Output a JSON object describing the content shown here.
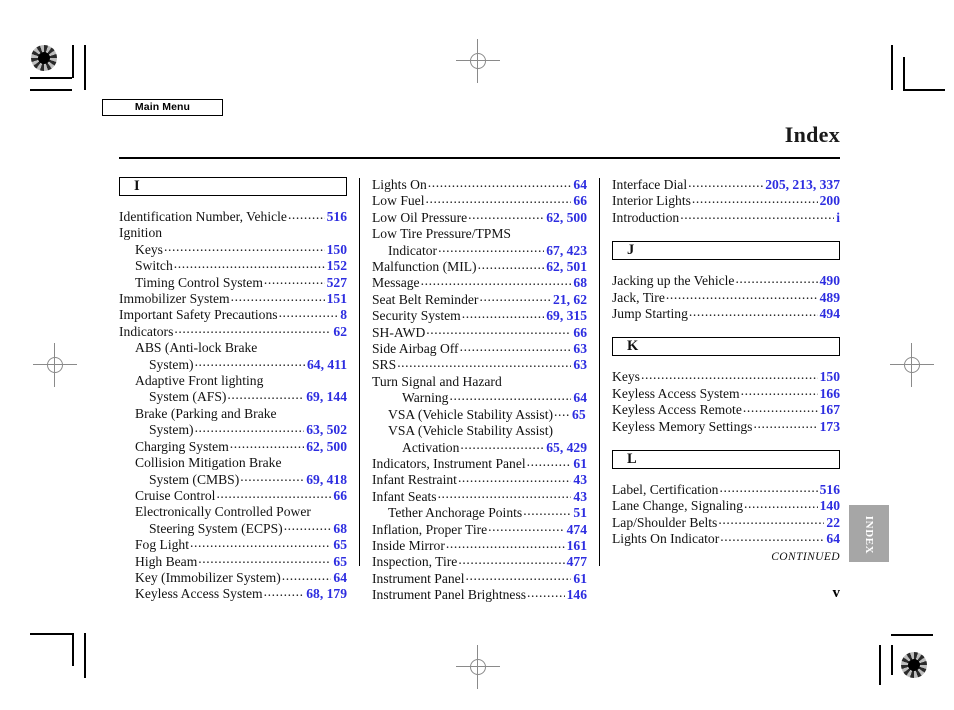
{
  "toolbar": {
    "main_menu_label": "Main Menu"
  },
  "header": {
    "title": "Index"
  },
  "footer": {
    "continued": "CONTINUED",
    "folio": "v",
    "thumb_tab": "INDEX"
  },
  "colors": {
    "page_number": "#2d2de0",
    "thumb_tab_bg": "#a6a6a6",
    "text": "#111111"
  },
  "columns": [
    {
      "id": "column-1",
      "blocks": [
        {
          "type": "letter",
          "letter": "I"
        },
        {
          "type": "entry",
          "label": "Identification Number, Vehicle",
          "pages": "516"
        },
        {
          "type": "plain",
          "label": "Ignition"
        },
        {
          "type": "entry",
          "indent": "sub",
          "label": "Keys",
          "pages": "150"
        },
        {
          "type": "entry",
          "indent": "sub",
          "label": "Switch",
          "pages": "152"
        },
        {
          "type": "entry",
          "indent": "sub",
          "label": "Timing Control System",
          "pages": "527"
        },
        {
          "type": "entry",
          "label": "Immobilizer System",
          "pages": "151"
        },
        {
          "type": "entry",
          "label": "Important Safety Precautions",
          "pages": "8"
        },
        {
          "type": "entry",
          "label": "Indicators",
          "pages": "62"
        },
        {
          "type": "plain",
          "indent": "sub",
          "label": "ABS (Anti-lock Brake"
        },
        {
          "type": "entry",
          "indent": "sub2",
          "label": "System)",
          "pages": "64, 411"
        },
        {
          "type": "plain",
          "indent": "sub",
          "label": "Adaptive Front lighting"
        },
        {
          "type": "entry",
          "indent": "sub2",
          "label": "System (AFS)",
          "pages": "69, 144"
        },
        {
          "type": "plain",
          "indent": "sub",
          "label": "Brake (Parking and Brake"
        },
        {
          "type": "entry",
          "indent": "sub2",
          "label": "System)",
          "pages": "63, 502"
        },
        {
          "type": "entry",
          "indent": "sub",
          "label": "Charging System",
          "pages": "62, 500"
        },
        {
          "type": "plain",
          "indent": "sub",
          "label": "Collision Mitigation Brake"
        },
        {
          "type": "entry",
          "indent": "sub2",
          "label": "System (CMBS)",
          "pages": "69, 418"
        },
        {
          "type": "entry",
          "indent": "sub",
          "label": "Cruise Control",
          "pages": "66"
        },
        {
          "type": "plain",
          "indent": "sub",
          "label": "Electronically Controlled Power"
        },
        {
          "type": "entry",
          "indent": "sub2",
          "label": "Steering System (ECPS)",
          "pages": "68"
        },
        {
          "type": "entry",
          "indent": "sub",
          "label": "Fog Light",
          "pages": "65"
        },
        {
          "type": "entry",
          "indent": "sub",
          "label": "High Beam",
          "pages": "65"
        },
        {
          "type": "entry",
          "indent": "sub",
          "label": "Key (Immobilizer System)",
          "pages": "64"
        },
        {
          "type": "entry",
          "indent": "sub",
          "label": "Keyless Access System",
          "pages": "68, 179"
        }
      ]
    },
    {
      "id": "column-2",
      "blocks": [
        {
          "type": "entry",
          "label": "Lights On",
          "pages": "64"
        },
        {
          "type": "entry",
          "label": "Low Fuel",
          "pages": "66"
        },
        {
          "type": "entry",
          "label": "Low Oil Pressure",
          "pages": "62, 500"
        },
        {
          "type": "plain",
          "label": "Low Tire Pressure/TPMS"
        },
        {
          "type": "entry",
          "indent": "sub",
          "label": "Indicator",
          "pages": "67, 423"
        },
        {
          "type": "entry",
          "label": "Malfunction (MIL)",
          "pages": "62, 501"
        },
        {
          "type": "entry",
          "label": "Message",
          "pages": "68"
        },
        {
          "type": "entry",
          "label": "Seat Belt Reminder",
          "pages": "21, 62"
        },
        {
          "type": "entry",
          "label": "Security System",
          "pages": "69, 315"
        },
        {
          "type": "entry",
          "label": "SH-AWD",
          "pages": "66"
        },
        {
          "type": "entry",
          "label": "Side Airbag Off",
          "pages": "63"
        },
        {
          "type": "entry",
          "label": "SRS",
          "pages": "63"
        },
        {
          "type": "plain",
          "label": "Turn Signal and Hazard"
        },
        {
          "type": "entry",
          "indent": "sub2",
          "label": "Warning",
          "pages": "64"
        },
        {
          "type": "entry",
          "indent": "sub",
          "label": "VSA (Vehicle Stability Assist)",
          "pages": "65",
          "short_leader": true
        },
        {
          "type": "plain",
          "indent": "sub",
          "label": "VSA (Vehicle Stability Assist)"
        },
        {
          "type": "entry",
          "indent": "sub2",
          "label": "Activation",
          "pages": "65, 429"
        },
        {
          "type": "entry",
          "label": "Indicators, Instrument Panel",
          "pages": "61"
        },
        {
          "type": "entry",
          "label": "Infant Restraint",
          "pages": "43"
        },
        {
          "type": "entry",
          "label": "Infant Seats",
          "pages": "43"
        },
        {
          "type": "entry",
          "indent": "sub",
          "label": "Tether Anchorage Points",
          "pages": "51"
        },
        {
          "type": "entry",
          "label": "Inflation, Proper Tire",
          "pages": "474"
        },
        {
          "type": "entry",
          "label": "Inside Mirror",
          "pages": "161"
        },
        {
          "type": "entry",
          "label": "Inspection, Tire",
          "pages": "477"
        },
        {
          "type": "entry",
          "label": "Instrument Panel",
          "pages": "61"
        },
        {
          "type": "entry",
          "label": "Instrument Panel Brightness",
          "pages": "146"
        }
      ]
    },
    {
      "id": "column-3",
      "blocks": [
        {
          "type": "entry",
          "label": "Interface Dial",
          "pages": "205, 213, 337"
        },
        {
          "type": "entry",
          "label": "Interior Lights",
          "pages": "200"
        },
        {
          "type": "entry",
          "label": "Introduction",
          "pages": "i"
        },
        {
          "type": "letter",
          "letter": "J",
          "spaced": true
        },
        {
          "type": "entry",
          "label": "Jacking up the Vehicle",
          "pages": "490"
        },
        {
          "type": "entry",
          "label": "Jack, Tire",
          "pages": "489"
        },
        {
          "type": "entry",
          "label": "Jump Starting",
          "pages": "494"
        },
        {
          "type": "letter",
          "letter": "K",
          "spaced": true
        },
        {
          "type": "entry",
          "label": "Keys",
          "pages": "150"
        },
        {
          "type": "entry",
          "label": "Keyless Access System",
          "pages": "166"
        },
        {
          "type": "entry",
          "label": "Keyless Access Remote",
          "pages": "167"
        },
        {
          "type": "entry",
          "label": "Keyless Memory Settings",
          "pages": "173"
        },
        {
          "type": "letter",
          "letter": "L",
          "spaced": true
        },
        {
          "type": "entry",
          "label": "Label, Certification",
          "pages": "516"
        },
        {
          "type": "entry",
          "label": "Lane Change, Signaling",
          "pages": "140"
        },
        {
          "type": "entry",
          "label": "Lap/Shoulder Belts",
          "pages": "22"
        },
        {
          "type": "entry",
          "label": "Lights On Indicator",
          "pages": "64"
        }
      ]
    }
  ]
}
